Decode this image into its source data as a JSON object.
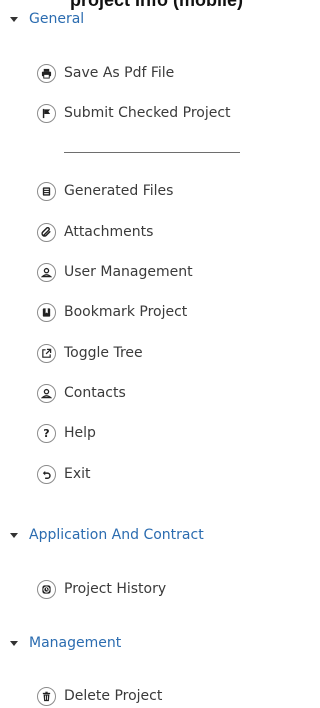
{
  "header": {
    "title": "project Info (mobile)"
  },
  "sections": [
    {
      "label": "General",
      "items": [
        {
          "label": "Save As Pdf File",
          "icon": "printer-icon"
        },
        {
          "label": "Submit Checked Project",
          "icon": "flag-icon"
        },
        {
          "label": "Generated Files",
          "icon": "files-icon"
        },
        {
          "label": "Attachments",
          "icon": "paperclip-icon"
        },
        {
          "label": "User Management",
          "icon": "user-icon"
        },
        {
          "label": "Bookmark Project",
          "icon": "bookmark-icon"
        },
        {
          "label": "Toggle Tree",
          "icon": "external-link-icon"
        },
        {
          "label": "Contacts",
          "icon": "contact-icon"
        },
        {
          "label": "Help",
          "icon": "help-icon",
          "glyph": "?"
        },
        {
          "label": "Exit",
          "icon": "undo-icon"
        }
      ]
    },
    {
      "label": "Application And Contract",
      "items": [
        {
          "label": "Project History",
          "icon": "history-icon"
        }
      ]
    },
    {
      "label": "Management",
      "items": [
        {
          "label": "Delete Project",
          "icon": "trash-icon"
        }
      ]
    }
  ]
}
